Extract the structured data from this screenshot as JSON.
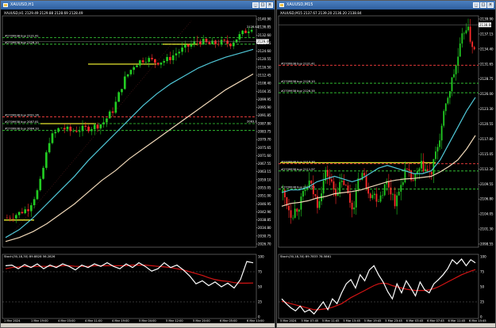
{
  "windows": [
    {
      "title": "XAUUSD,H1",
      "price_header": "XAUUSD,H1  2129.49  2129.88  2128.69  2128.49",
      "sub_title": "Stoch(30,18,30) 89.8828 56.2826",
      "x_labels": [
        "1 Mar 2024",
        "1 Mar 19:00",
        "4 Mar 03:00",
        "4 Mar 11:00",
        "4 Mar 19:00",
        "5 Mar 04:00",
        "5 Mar 12:00",
        "5 Mar 20:00",
        "6 Mar 05:00",
        "6 Mar 13:00"
      ],
      "y_labels": [
        "2140.90",
        "2136.85",
        "2132.60",
        "2128.75",
        "2124.60",
        "2120.55",
        "2116.50",
        "2112.45",
        "2108.40",
        "2104.35",
        "2099.95",
        "2095.90",
        "2091.85",
        "2087.80",
        "2083.75",
        "2079.70",
        "2075.65",
        "2071.60",
        "2067.55",
        "2063.15",
        "2059.10",
        "2055.05",
        "2051.00",
        "2046.95",
        "2042.90",
        "2038.85",
        "2034.80",
        "2030.75",
        "2026.70"
      ],
      "sub_y_labels": [
        "100",
        "75",
        "50",
        "25",
        "0"
      ],
      "current_price": "2129.49",
      "ref_tag": "2128.43",
      "ref_tag2": "2083.3",
      "level_labels": [
        "#2709938 buy 2131.41",
        "#2709938 buy 2128.10",
        "#2709938 buy 2091.26",
        "#2709938 buy 2087.81",
        "#2709938 buy 2084.33"
      ]
    },
    {
      "title": "XAUUSD,M15",
      "price_header": "XAUUSD,M15  2137.67  2139.20  2136.20  2138.84",
      "sub_title": "Stoch(30,18,30) 89.7833 78.5861",
      "x_labels": [
        "5 Mar 2024",
        "5 Mar 07:45",
        "5 Mar 11:45",
        "5 Mar 15:45",
        "5 Mar 19:45",
        "5 Mar 23:45",
        "6 Mar 03:45",
        "6 Mar 07:45",
        "6 Mar 11:45",
        "6 Mar 15:45"
      ],
      "y_labels": [
        "2139.90",
        "2137.15",
        "2134.40",
        "2131.65",
        "2128.75",
        "2126.00",
        "2123.30",
        "2120.55",
        "2117.80",
        "2115.05",
        "2112.30",
        "2109.55",
        "2106.80",
        "2104.05",
        "2101.30",
        "2098.55"
      ],
      "sub_y_labels": [
        "100",
        "75",
        "50",
        "25",
        "0"
      ],
      "current_price": "2138.84",
      "level_labels": [
        "#2709938 buy 2131.41",
        "#2709938 buy 2128.10",
        "#2709938 buy 2126.35",
        "#2709938 buy 2113.30",
        "#2709938 buy 2111.97",
        "#2709938 buy 2108.64"
      ]
    }
  ],
  "colors": {
    "bull": "#22cc22",
    "bear": "#ff2a2a",
    "ma_fast": "#50c8d8",
    "ma_slow": "#f0d8b8",
    "level_green": "#39d639",
    "level_red": "#ff4040",
    "yellow_line": "#ffff33",
    "stoch_main": "#ffffff",
    "stoch_signal": "#d41414"
  },
  "chart_data": [
    {
      "type": "candlestick",
      "title": "XAUUSD,H1",
      "ylim": [
        2026.7,
        2140.9
      ],
      "levels": [
        2131.41,
        2128.1,
        2091.26,
        2087.81,
        2084.33
      ],
      "ma_fast": [
        2030,
        2034,
        2040,
        2047,
        2054,
        2061,
        2069,
        2076,
        2083,
        2090,
        2097,
        2103,
        2108,
        2112,
        2116,
        2119,
        2121.5,
        2123.5,
        2125.5
      ],
      "ma_slow": [
        2028,
        2030,
        2033,
        2037,
        2042,
        2047,
        2053,
        2059,
        2064,
        2070,
        2075,
        2080,
        2085,
        2090,
        2095,
        2100,
        2105,
        2109,
        2113
      ],
      "stoch_main": [
        85,
        86,
        80,
        87,
        82,
        88,
        80,
        86,
        82,
        88,
        84,
        78,
        86,
        82,
        88,
        84,
        90,
        84,
        80,
        88,
        82,
        90,
        84,
        76,
        80,
        90,
        82,
        86,
        78,
        68,
        55,
        60,
        52,
        58,
        50,
        56,
        48,
        62,
        92,
        89.88
      ],
      "stoch_signal": [
        80,
        82,
        83,
        84,
        83,
        84,
        84,
        84,
        84,
        85,
        85,
        84,
        84,
        84,
        85,
        85,
        85,
        85,
        85,
        85,
        86,
        86,
        86,
        85,
        84,
        83,
        82,
        80,
        78,
        75,
        72,
        69,
        65,
        62,
        60,
        59,
        57,
        56,
        56,
        56.28
      ]
    },
    {
      "type": "candlestick",
      "title": "XAUUSD,M15",
      "ylim": [
        2098.55,
        2139.9
      ],
      "levels": [
        2131.41,
        2128.1,
        2126.35,
        2113.3,
        2111.97,
        2108.64
      ],
      "ma_fast": [
        2108,
        2108.5,
        2108.5,
        2109,
        2110,
        2110.5,
        2111,
        2110.5,
        2110,
        2110.5,
        2111.5,
        2112.5,
        2113,
        2112.5,
        2112,
        2111.5,
        2111.5,
        2112,
        2114,
        2117,
        2120,
        2123,
        2125.5
      ],
      "ma_slow": [
        2105.5,
        2106,
        2106.2,
        2106.5,
        2107,
        2107.3,
        2107.8,
        2108,
        2108.2,
        2108.5,
        2109,
        2109.5,
        2110,
        2110.3,
        2110.5,
        2110.6,
        2110.8,
        2111,
        2111.8,
        2112.8,
        2114,
        2116,
        2118.5
      ],
      "stoch_main": [
        30,
        22,
        15,
        10,
        18,
        8,
        12,
        5,
        15,
        25,
        12,
        30,
        22,
        40,
        55,
        62,
        48,
        70,
        60,
        78,
        85,
        70,
        58,
        42,
        30,
        55,
        40,
        60,
        48,
        35,
        58,
        45,
        40,
        55,
        62,
        70,
        80,
        95,
        88,
        96,
        85,
        95,
        89.78
      ],
      "stoch_signal": [
        26,
        24,
        22,
        20,
        18,
        16,
        14,
        12,
        12,
        13,
        14,
        16,
        19,
        22,
        27,
        32,
        36,
        40,
        44,
        48,
        52,
        55,
        56,
        55,
        52,
        50,
        48,
        46,
        45,
        44,
        44,
        44,
        45,
        47,
        50,
        54,
        58,
        62,
        66,
        70,
        73,
        76,
        78.59
      ]
    }
  ]
}
